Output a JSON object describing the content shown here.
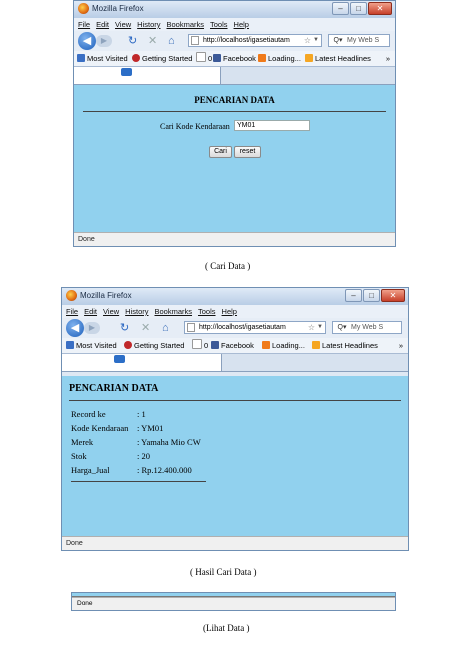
{
  "browser": {
    "title": "Mozilla Firefox",
    "menu": [
      "File",
      "Edit",
      "View",
      "History",
      "Bookmarks",
      "Tools",
      "Help"
    ],
    "url": "http://localhost/igasetiautam",
    "search_placeholder": "My Web S",
    "bookmarks": [
      {
        "label": "Most Visited",
        "icon": "most-visited-icon",
        "color": "#3a6fc4"
      },
      {
        "label": "Getting Started",
        "icon": "getting-started-icon",
        "color": "#c0282a"
      },
      {
        "label": "0",
        "icon": "page-icon",
        "color": "#ffffff"
      },
      {
        "label": "Facebook",
        "icon": "facebook-icon",
        "color": "#3b5998"
      },
      {
        "label": "Loading...",
        "icon": "blogger-icon",
        "color": "#f07a1a"
      },
      {
        "label": "Latest Headlines",
        "icon": "rss-icon",
        "color": "#f5a623"
      }
    ],
    "bookmarks_more": "»",
    "status": "Done"
  },
  "screen1": {
    "heading": "PENCARIAN DATA",
    "field_label": "Cari Kode Kendaraan",
    "field_value": "YM01",
    "search_button": "Cari",
    "reset_button": "reset",
    "caption": "( Cari Data )"
  },
  "screen2": {
    "heading": "PENCARIAN DATA",
    "records": [
      {
        "label": "Record ke",
        "value": ": 1"
      },
      {
        "label": "Kode Kendaraan",
        "value": ": YM01"
      },
      {
        "label": "Merek",
        "value": ": Yamaha Mio CW"
      },
      {
        "label": "Stok",
        "value": ": 20"
      },
      {
        "label": "Harga_Jual",
        "value": ": Rp.12.400.000"
      }
    ],
    "caption": "( Hasil Cari Data )"
  },
  "screen3": {
    "status": "Done",
    "caption": "(Lihat Data )"
  },
  "colors": {
    "content_bg": "#91d1ee",
    "accent": "#1d5fbb"
  }
}
